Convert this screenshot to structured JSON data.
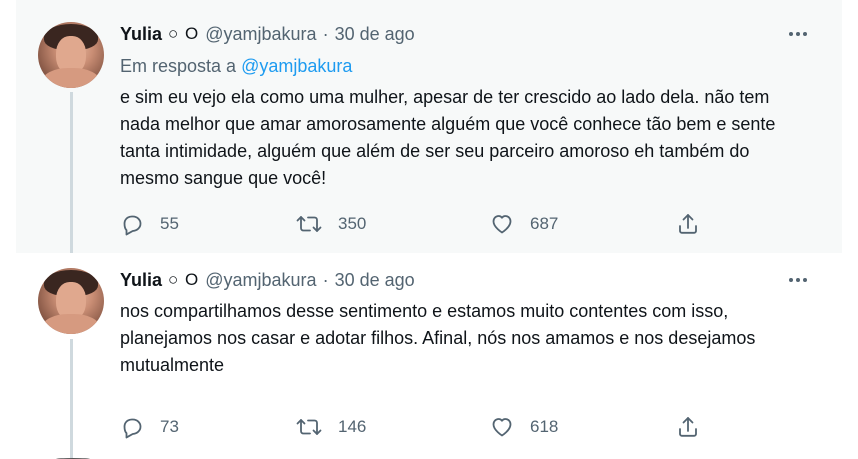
{
  "tweets": [
    {
      "author_name": "Yulia",
      "author_emoji": "○ O",
      "handle": "@yamjbakura",
      "separator": "·",
      "date": "30 de ago",
      "reply_prefix": "Em resposta a",
      "reply_to": "@yamjbakura",
      "text": "e sim eu vejo ela como uma mulher, apesar de ter crescido ao lado dela. não tem nada melhor que amar amorosamente alguém que você conhece tão bem e sente tanta intimidade, alguém que além de ser seu parceiro amoroso eh também do mesmo sangue que você!",
      "replies": "55",
      "retweets": "350",
      "likes": "687"
    },
    {
      "author_name": "Yulia",
      "author_emoji": "○ O",
      "handle": "@yamjbakura",
      "separator": "·",
      "date": "30 de ago",
      "text": "nos compartilhamos desse sentimento e estamos muito contentes com isso, planejamos nos casar e adotar filhos. Afinal, nós nos amamos e nos desejamos mutualmente",
      "replies": "73",
      "retweets": "146",
      "likes": "618"
    }
  ],
  "icons": {
    "more": "more-horizontal-icon",
    "reply": "reply-bubble-icon",
    "retweet": "retweet-icon",
    "like": "heart-icon",
    "share": "share-icon"
  },
  "colors": {
    "accent": "#1d9bf0",
    "muted": "#536471",
    "text": "#0f1419",
    "highlight_bg": "#f7f9f9",
    "thread_line": "#cfd9de"
  }
}
